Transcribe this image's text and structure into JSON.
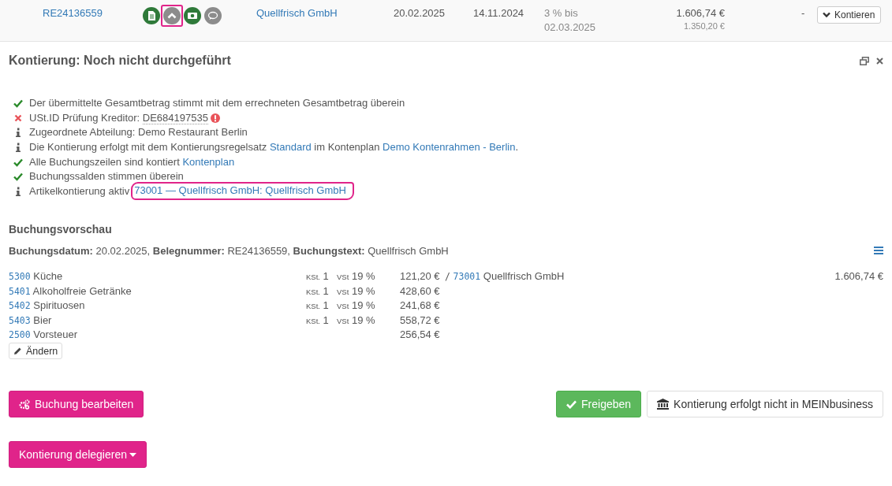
{
  "invoice_row": {
    "invoice_number": "RE24136559",
    "icons": [
      {
        "kind": "document",
        "color": "#2f7a3a",
        "highlighted": false
      },
      {
        "kind": "chevron-up",
        "color": "#8c8c8c",
        "highlighted": true
      },
      {
        "kind": "money",
        "color": "#2f7a3a",
        "highlighted": false
      },
      {
        "kind": "comment",
        "color": "#8c8c8c",
        "highlighted": false
      }
    ],
    "supplier": "Quellfrisch GmbH",
    "invoice_date": "20.02.2025",
    "due_date": "14.11.2024",
    "discount": [
      "3 % bis",
      "02.03.2025"
    ],
    "amount": "1.606,74 €",
    "net_amount": "1.350,20 €",
    "column_8": "-",
    "button": "Kontieren"
  },
  "panel": {
    "title": "Kontierung: Noch nicht durchgeführt",
    "checks": [
      {
        "kind": "ok",
        "alert": false,
        "highlighted": false,
        "parts": [
          {
            "kind": "text",
            "text": "Der übermittelte Gesamtbetrag stimmt mit dem errechneten Gesamtbetrag überein"
          }
        ]
      },
      {
        "kind": "error",
        "alert": true,
        "highlighted": false,
        "parts": [
          {
            "kind": "text",
            "text": "USt.ID Prüfung Kreditor: "
          },
          {
            "kind": "dotted",
            "text": "DE684197535"
          }
        ]
      },
      {
        "kind": "info",
        "alert": false,
        "highlighted": false,
        "parts": [
          {
            "kind": "text",
            "text": "Zugeordnete Abteilung: Demo Restaurant Berlin"
          }
        ]
      },
      {
        "kind": "info",
        "alert": false,
        "highlighted": false,
        "parts": [
          {
            "kind": "text",
            "text": "Die Kontierung erfolgt mit dem Kontierungsregelsatz "
          },
          {
            "kind": "link",
            "text": "Standard"
          },
          {
            "kind": "text",
            "text": " im Kontenplan "
          },
          {
            "kind": "link",
            "text": "Demo Kontenrahmen - Berlin"
          },
          {
            "kind": "text",
            "text": "."
          }
        ]
      },
      {
        "kind": "ok",
        "alert": false,
        "highlighted": false,
        "parts": [
          {
            "kind": "text",
            "text": "Alle Buchungszeilen sind kontiert "
          },
          {
            "kind": "link",
            "text": "Kontenplan"
          }
        ]
      },
      {
        "kind": "ok",
        "alert": false,
        "highlighted": false,
        "parts": [
          {
            "kind": "text",
            "text": "Buchungssalden stimmen überein"
          }
        ]
      },
      {
        "kind": "info",
        "alert": false,
        "highlighted": true,
        "parts": [
          {
            "kind": "text",
            "text": "Artikelkontierung aktiv"
          },
          {
            "kind": "link",
            "text": "73001 — Quellfrisch GmbH: Quellfrisch GmbH"
          }
        ]
      }
    ]
  },
  "booking": {
    "heading": "Buchungsvorschau",
    "meta": "**Buchungsdatum:**  20.02.2025, **Belegnummer:**  RE24136559, **Buchungstext:**  Quellfrisch GmbH",
    "lines": [
      {
        "account": "5300",
        "name": "Küche",
        "kst_label": "KSt.",
        "kst": "1",
        "vst_label": "VSt",
        "vst": "19 %",
        "amount": "121,20 €"
      },
      {
        "account": "5401",
        "name": "Alkoholfreie Getränke",
        "kst_label": "KSt.",
        "kst": "1",
        "vst_label": "VSt",
        "vst": "19 %",
        "amount": "428,60 €"
      },
      {
        "account": "5402",
        "name": "Spirituosen",
        "kst_label": "KSt.",
        "kst": "1",
        "vst_label": "VSt",
        "vst": "19 %",
        "amount": "241,68 €"
      },
      {
        "account": "5403",
        "name": "Bier",
        "kst_label": "KSt.",
        "kst": "1",
        "vst_label": "VSt",
        "vst": "19 %",
        "amount": "558,72 €"
      },
      {
        "account": "2500",
        "name": "Vorsteuer",
        "amount": "256,54 €"
      }
    ],
    "contra": {
      "separator": "/",
      "account": "73001",
      "name": "Quellfrisch GmbH",
      "total": "1.606,74 €"
    },
    "edit_button": "Ändern"
  },
  "actions": {
    "left": [
      {
        "kind": "primary",
        "label": "Buchung bearbeiten"
      }
    ],
    "right": [
      {
        "kind": "success",
        "label": "Freigeben"
      },
      {
        "kind": "default",
        "label": "Kontierung erfolgt nicht in MEINbusiness"
      }
    ]
  },
  "delegate_button": {
    "kind": "primary",
    "label": "Kontierung delegieren"
  }
}
